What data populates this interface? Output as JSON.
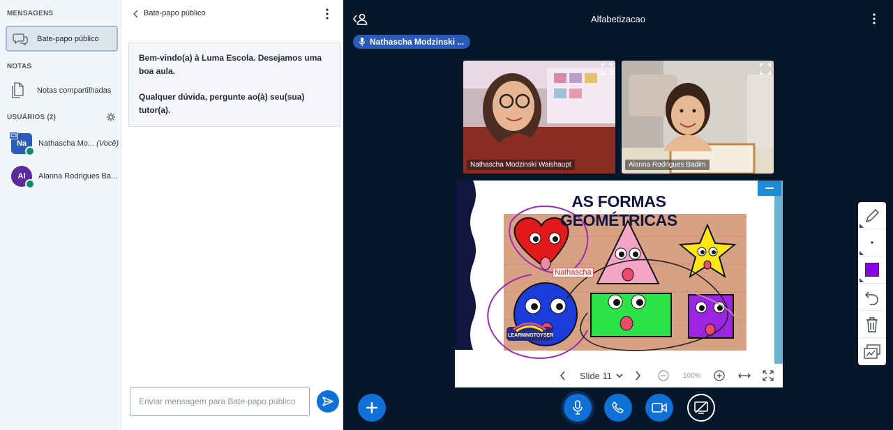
{
  "sidebar": {
    "messages_title": "MENSAGENS",
    "public_chat": "Bate-papo público",
    "notes_title": "NOTAS",
    "shared_notes": "Notas compartilhadas",
    "users_title": "USUÁRIOS (2)",
    "users": [
      {
        "initials": "Na",
        "name": "Nathascha Mo...",
        "you": "(Você)",
        "color": "#2A5BB8"
      },
      {
        "initials": "Al",
        "name": "Alanna Rodrigues Ba...",
        "you": "",
        "color": "#5D2A9E"
      }
    ]
  },
  "chat": {
    "header": "Bate-papo público",
    "welcome_line1": "Bem-vindo(a) à Luma Escola. Desejamos uma boa aula.",
    "welcome_line2": "Qualquer dúvida, pergunte ao(à) seu(sua) tutor(a).",
    "input_placeholder": "Enviar mensagem para Bate-papo público"
  },
  "main": {
    "room_title": "Alfabetizacao",
    "presenter": "Nathascha Modzinski ...",
    "cams": [
      {
        "name": "Nathascha Modzinski Waishaupt"
      },
      {
        "name": "Alanna Rodrigues Badim"
      }
    ],
    "slide": {
      "title": "AS FORMAS GEOMÉTRICAS",
      "cursor_label": "Nathascha",
      "logo_text": "LEARNINGTOYSER",
      "slide_label": "Slide 11",
      "zoom": "100%"
    }
  },
  "colors": {
    "accent": "#0F70D7",
    "pen_color": "#8A00E6",
    "dark_bg": "#06172A"
  }
}
